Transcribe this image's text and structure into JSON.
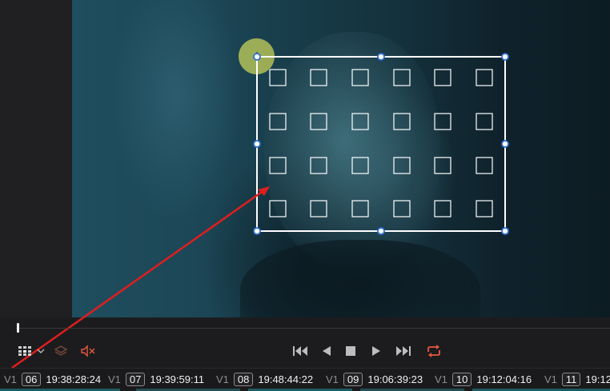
{
  "colors": {
    "accent_red": "#e8583f",
    "annotation_arrow": "#e01e1e",
    "handle_blue": "#2e6fd6",
    "cursor_halo": "#c8d25a"
  },
  "viewer": {
    "overlay_tool": "transform-grid-overlay",
    "cursor_icon": "move-cursor-icon"
  },
  "controls": {
    "left_icons": [
      "grid-view-icon",
      "chevron-down-icon",
      "layers-icon",
      "mute-audio-icon"
    ],
    "transport_icons": [
      "skip-to-start-icon",
      "play-reverse-icon",
      "stop-icon",
      "play-icon",
      "skip-to-end-icon",
      "loop-icon"
    ]
  },
  "clips": [
    {
      "track": "V1",
      "number": "06",
      "timecode": "19:38:28:24"
    },
    {
      "track": "V1",
      "number": "07",
      "timecode": "19:39:59:11"
    },
    {
      "track": "V1",
      "number": "08",
      "timecode": "19:48:44:22"
    },
    {
      "track": "V1",
      "number": "09",
      "timecode": "19:06:39:23"
    },
    {
      "track": "V1",
      "number": "10",
      "timecode": "19:12:04:16"
    },
    {
      "track": "V1",
      "number": "11",
      "timecode": "19:12"
    }
  ]
}
